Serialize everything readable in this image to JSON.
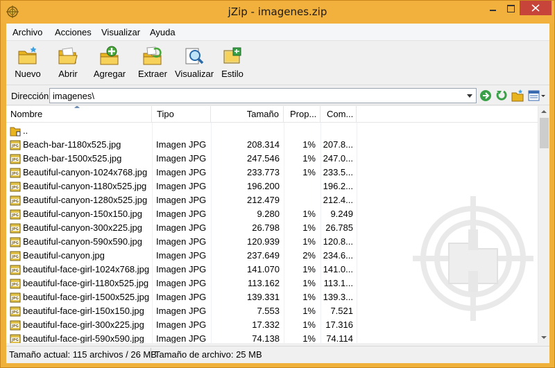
{
  "window": {
    "title": "jZip - imagenes.zip"
  },
  "menu": [
    "Archivo",
    "Acciones",
    "Visualizar",
    "Ayuda"
  ],
  "toolbar": {
    "buttons": [
      {
        "label": "Nuevo",
        "icon": "new-folder-icon"
      },
      {
        "label": "Abrir",
        "icon": "open-folder-icon"
      },
      {
        "label": "Agregar",
        "icon": "add-icon"
      },
      {
        "label": "Extraer",
        "icon": "extract-icon"
      },
      {
        "label": "Visualizar",
        "icon": "view-icon"
      },
      {
        "label": "Estilo",
        "icon": "style-icon"
      }
    ]
  },
  "address": {
    "label": "Dirección",
    "value": "imagenes\\"
  },
  "columns": {
    "name": "Nombre",
    "type": "Tipo",
    "size": "Tamaño",
    "prop": "Prop...",
    "comp": "Com..."
  },
  "files": [
    {
      "name": "..",
      "type": "",
      "size": "",
      "prop": "",
      "comp": "",
      "kind": "folder"
    },
    {
      "name": "Beach-bar-1180x525.jpg",
      "type": "Imagen JPG",
      "size": "208.314",
      "prop": "1%",
      "comp": "207.8...",
      "kind": "jpg"
    },
    {
      "name": "Beach-bar-1500x525.jpg",
      "type": "Imagen JPG",
      "size": "247.546",
      "prop": "1%",
      "comp": "247.0...",
      "kind": "jpg"
    },
    {
      "name": "Beautiful-canyon-1024x768.jpg",
      "type": "Imagen JPG",
      "size": "233.773",
      "prop": "1%",
      "comp": "233.5...",
      "kind": "jpg"
    },
    {
      "name": "Beautiful-canyon-1180x525.jpg",
      "type": "Imagen JPG",
      "size": "196.200",
      "prop": "",
      "comp": "196.2...",
      "kind": "jpg"
    },
    {
      "name": "Beautiful-canyon-1280x525.jpg",
      "type": "Imagen JPG",
      "size": "212.479",
      "prop": "",
      "comp": "212.4...",
      "kind": "jpg"
    },
    {
      "name": "Beautiful-canyon-150x150.jpg",
      "type": "Imagen JPG",
      "size": "9.280",
      "prop": "1%",
      "comp": "9.249",
      "kind": "jpg"
    },
    {
      "name": "Beautiful-canyon-300x225.jpg",
      "type": "Imagen JPG",
      "size": "26.798",
      "prop": "1%",
      "comp": "26.785",
      "kind": "jpg"
    },
    {
      "name": "Beautiful-canyon-590x590.jpg",
      "type": "Imagen JPG",
      "size": "120.939",
      "prop": "1%",
      "comp": "120.8...",
      "kind": "jpg"
    },
    {
      "name": "Beautiful-canyon.jpg",
      "type": "Imagen JPG",
      "size": "237.649",
      "prop": "2%",
      "comp": "234.6...",
      "kind": "jpg"
    },
    {
      "name": "beautiful-face-girl-1024x768.jpg",
      "type": "Imagen JPG",
      "size": "141.070",
      "prop": "1%",
      "comp": "141.0...",
      "kind": "jpg"
    },
    {
      "name": "beautiful-face-girl-1180x525.jpg",
      "type": "Imagen JPG",
      "size": "113.162",
      "prop": "1%",
      "comp": "113.1...",
      "kind": "jpg"
    },
    {
      "name": "beautiful-face-girl-1500x525.jpg",
      "type": "Imagen JPG",
      "size": "139.331",
      "prop": "1%",
      "comp": "139.3...",
      "kind": "jpg"
    },
    {
      "name": "beautiful-face-girl-150x150.jpg",
      "type": "Imagen JPG",
      "size": "7.553",
      "prop": "1%",
      "comp": "7.521",
      "kind": "jpg"
    },
    {
      "name": "beautiful-face-girl-300x225.jpg",
      "type": "Imagen JPG",
      "size": "17.332",
      "prop": "1%",
      "comp": "17.316",
      "kind": "jpg"
    },
    {
      "name": "beautiful-face-girl-590x590.jpg",
      "type": "Imagen JPG",
      "size": "74.138",
      "prop": "1%",
      "comp": "74.114",
      "kind": "jpg"
    }
  ],
  "status": {
    "current": "Tamaño actual: 115 archivos / 26 MB",
    "archive": "Tamaño de archivo: 25 MB"
  },
  "colors": {
    "title_bar": "#f2b13c",
    "close_button": "#c7443a",
    "accent": "#6d8db3"
  }
}
